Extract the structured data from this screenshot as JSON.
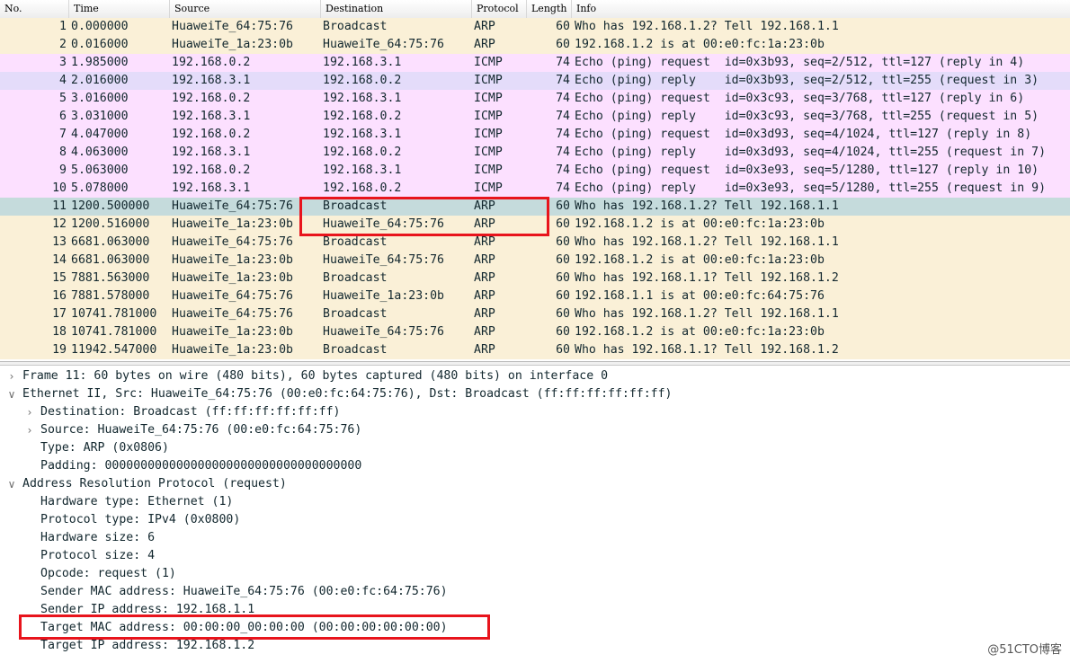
{
  "columns": {
    "no": "No.",
    "time": "Time",
    "source": "Source",
    "destination": "Destination",
    "protocol": "Protocol",
    "length": "Length",
    "info": "Info"
  },
  "packets": [
    {
      "no": "1",
      "time": "0.000000",
      "source": "HuaweiTe_64:75:76",
      "destination": "Broadcast",
      "protocol": "ARP",
      "length": "60",
      "info": "Who has 192.168.1.2? Tell 192.168.1.1",
      "style": "arp"
    },
    {
      "no": "2",
      "time": "0.016000",
      "source": "HuaweiTe_1a:23:0b",
      "destination": "HuaweiTe_64:75:76",
      "protocol": "ARP",
      "length": "60",
      "info": "192.168.1.2 is at 00:e0:fc:1a:23:0b",
      "style": "arp"
    },
    {
      "no": "3",
      "time": "1.985000",
      "source": "192.168.0.2",
      "destination": "192.168.3.1",
      "protocol": "ICMP",
      "length": "74",
      "info": "Echo (ping) request  id=0x3b93, seq=2/512, ttl=127 (reply in 4)",
      "style": "icmp"
    },
    {
      "no": "4",
      "time": "2.016000",
      "source": "192.168.3.1",
      "destination": "192.168.0.2",
      "protocol": "ICMP",
      "length": "74",
      "info": "Echo (ping) reply    id=0x3b93, seq=2/512, ttl=255 (request in 3)",
      "style": "icmp-alt"
    },
    {
      "no": "5",
      "time": "3.016000",
      "source": "192.168.0.2",
      "destination": "192.168.3.1",
      "protocol": "ICMP",
      "length": "74",
      "info": "Echo (ping) request  id=0x3c93, seq=3/768, ttl=127 (reply in 6)",
      "style": "icmp"
    },
    {
      "no": "6",
      "time": "3.031000",
      "source": "192.168.3.1",
      "destination": "192.168.0.2",
      "protocol": "ICMP",
      "length": "74",
      "info": "Echo (ping) reply    id=0x3c93, seq=3/768, ttl=255 (request in 5)",
      "style": "icmp"
    },
    {
      "no": "7",
      "time": "4.047000",
      "source": "192.168.0.2",
      "destination": "192.168.3.1",
      "protocol": "ICMP",
      "length": "74",
      "info": "Echo (ping) request  id=0x3d93, seq=4/1024, ttl=127 (reply in 8)",
      "style": "icmp"
    },
    {
      "no": "8",
      "time": "4.063000",
      "source": "192.168.3.1",
      "destination": "192.168.0.2",
      "protocol": "ICMP",
      "length": "74",
      "info": "Echo (ping) reply    id=0x3d93, seq=4/1024, ttl=255 (request in 7)",
      "style": "icmp"
    },
    {
      "no": "9",
      "time": "5.063000",
      "source": "192.168.0.2",
      "destination": "192.168.3.1",
      "protocol": "ICMP",
      "length": "74",
      "info": "Echo (ping) request  id=0x3e93, seq=5/1280, ttl=127 (reply in 10)",
      "style": "icmp"
    },
    {
      "no": "10",
      "time": "5.078000",
      "source": "192.168.3.1",
      "destination": "192.168.0.2",
      "protocol": "ICMP",
      "length": "74",
      "info": "Echo (ping) reply    id=0x3e93, seq=5/1280, ttl=255 (request in 9)",
      "style": "icmp"
    },
    {
      "no": "11",
      "time": "1200.500000",
      "source": "HuaweiTe_64:75:76",
      "destination": "Broadcast",
      "protocol": "ARP",
      "length": "60",
      "info": "Who has 192.168.1.2? Tell 192.168.1.1",
      "style": "selected"
    },
    {
      "no": "12",
      "time": "1200.516000",
      "source": "HuaweiTe_1a:23:0b",
      "destination": "HuaweiTe_64:75:76",
      "protocol": "ARP",
      "length": "60",
      "info": "192.168.1.2 is at 00:e0:fc:1a:23:0b",
      "style": "arp"
    },
    {
      "no": "13",
      "time": "6681.063000",
      "source": "HuaweiTe_64:75:76",
      "destination": "Broadcast",
      "protocol": "ARP",
      "length": "60",
      "info": "Who has 192.168.1.2? Tell 192.168.1.1",
      "style": "arp"
    },
    {
      "no": "14",
      "time": "6681.063000",
      "source": "HuaweiTe_1a:23:0b",
      "destination": "HuaweiTe_64:75:76",
      "protocol": "ARP",
      "length": "60",
      "info": "192.168.1.2 is at 00:e0:fc:1a:23:0b",
      "style": "arp"
    },
    {
      "no": "15",
      "time": "7881.563000",
      "source": "HuaweiTe_1a:23:0b",
      "destination": "Broadcast",
      "protocol": "ARP",
      "length": "60",
      "info": "Who has 192.168.1.1? Tell 192.168.1.2",
      "style": "arp"
    },
    {
      "no": "16",
      "time": "7881.578000",
      "source": "HuaweiTe_64:75:76",
      "destination": "HuaweiTe_1a:23:0b",
      "protocol": "ARP",
      "length": "60",
      "info": "192.168.1.1 is at 00:e0:fc:64:75:76",
      "style": "arp"
    },
    {
      "no": "17",
      "time": "10741.781000",
      "source": "HuaweiTe_64:75:76",
      "destination": "Broadcast",
      "protocol": "ARP",
      "length": "60",
      "info": "Who has 192.168.1.2? Tell 192.168.1.1",
      "style": "arp"
    },
    {
      "no": "18",
      "time": "10741.781000",
      "source": "HuaweiTe_1a:23:0b",
      "destination": "HuaweiTe_64:75:76",
      "protocol": "ARP",
      "length": "60",
      "info": "192.168.1.2 is at 00:e0:fc:1a:23:0b",
      "style": "arp"
    },
    {
      "no": "19",
      "time": "11942.547000",
      "source": "HuaweiTe_1a:23:0b",
      "destination": "Broadcast",
      "protocol": "ARP",
      "length": "60",
      "info": "Who has 192.168.1.1? Tell 192.168.1.2",
      "style": "arp"
    }
  ],
  "details": [
    {
      "level": 0,
      "twisty": "collapsed",
      "text": "Frame 11: 60 bytes on wire (480 bits), 60 bytes captured (480 bits) on interface 0"
    },
    {
      "level": 0,
      "twisty": "expanded",
      "text": "Ethernet II, Src: HuaweiTe_64:75:76 (00:e0:fc:64:75:76), Dst: Broadcast (ff:ff:ff:ff:ff:ff)"
    },
    {
      "level": 1,
      "twisty": "collapsed",
      "text": "Destination: Broadcast (ff:ff:ff:ff:ff:ff)"
    },
    {
      "level": 1,
      "twisty": "collapsed",
      "text": "Source: HuaweiTe_64:75:76 (00:e0:fc:64:75:76)"
    },
    {
      "level": 1,
      "twisty": "none",
      "text": "Type: ARP (0x0806)"
    },
    {
      "level": 1,
      "twisty": "none",
      "text": "Padding: 000000000000000000000000000000000000"
    },
    {
      "level": 0,
      "twisty": "expanded",
      "text": "Address Resolution Protocol (request)"
    },
    {
      "level": 1,
      "twisty": "none",
      "text": "Hardware type: Ethernet (1)"
    },
    {
      "level": 1,
      "twisty": "none",
      "text": "Protocol type: IPv4 (0x0800)"
    },
    {
      "level": 1,
      "twisty": "none",
      "text": "Hardware size: 6"
    },
    {
      "level": 1,
      "twisty": "none",
      "text": "Protocol size: 4"
    },
    {
      "level": 1,
      "twisty": "none",
      "text": "Opcode: request (1)"
    },
    {
      "level": 1,
      "twisty": "none",
      "text": "Sender MAC address: HuaweiTe_64:75:76 (00:e0:fc:64:75:76)"
    },
    {
      "level": 1,
      "twisty": "none",
      "text": "Sender IP address: 192.168.1.1"
    },
    {
      "level": 1,
      "twisty": "none",
      "text": "Target MAC address: 00:00:00_00:00:00 (00:00:00:00:00:00)"
    },
    {
      "level": 1,
      "twisty": "none",
      "text": "Target IP address: 192.168.1.2"
    }
  ],
  "watermark": "@51CTO博客",
  "colors": {
    "arp_row": "#faf0d7",
    "icmp_row": "#fce0ff",
    "selected_row": "#c5dbdc",
    "annotation_box": "#e8141c"
  }
}
